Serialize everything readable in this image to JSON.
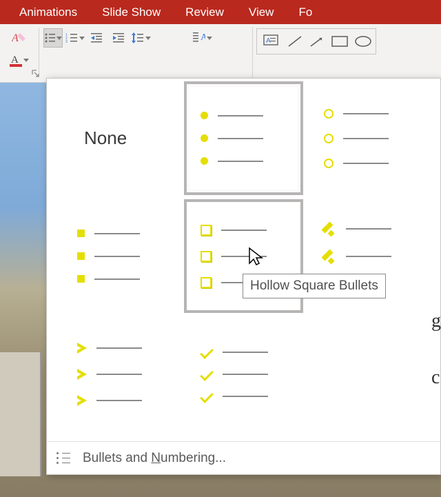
{
  "ribbon": {
    "tabs": [
      "Animations",
      "Slide Show",
      "Review",
      "View",
      "Fo"
    ]
  },
  "bullet_gallery": {
    "none_label": "None",
    "options": [
      {
        "id": "none",
        "name": "None"
      },
      {
        "id": "filled-round",
        "name": "Filled Round Bullets",
        "selected": true
      },
      {
        "id": "hollow-round",
        "name": "Hollow Round Bullets"
      },
      {
        "id": "filled-square",
        "name": "Filled Square Bullets"
      },
      {
        "id": "hollow-square",
        "name": "Hollow Square Bullets",
        "hover": true
      },
      {
        "id": "four-diamonds",
        "name": "Star Bullets"
      },
      {
        "id": "arrow",
        "name": "Arrow Bullets"
      },
      {
        "id": "checkmark",
        "name": "Checkmark Bullets"
      }
    ],
    "footer_prefix": "Bullets and ",
    "footer_mnemonic": "N",
    "footer_suffix": "umbering...",
    "bullet_color": "#e5de00"
  },
  "tooltip": {
    "text": "Hollow Square Bullets"
  }
}
